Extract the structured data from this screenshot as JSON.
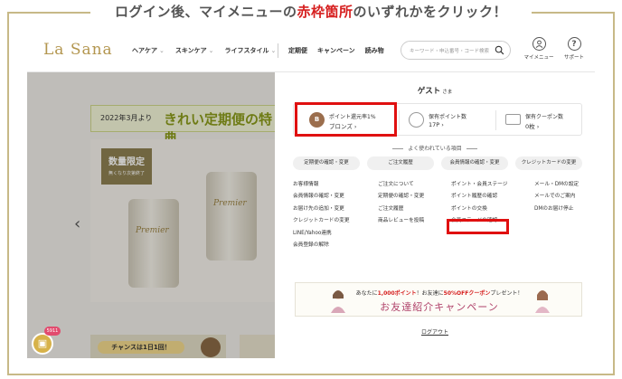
{
  "instruction": {
    "prefix": "ログイン後、マイメニューの",
    "highlight": "赤枠箇所",
    "suffix": "のいずれかをクリック！"
  },
  "header": {
    "logo": "La Sana",
    "nav": [
      "ヘアケア",
      "スキンケア",
      "ライフスタイル"
    ],
    "nav2": [
      "定期便",
      "キャンペーン",
      "読み物"
    ],
    "search_placeholder": "キーワード・申込番号・コード検索",
    "mymenu_label": "マイメニュー",
    "support_label": "サポート",
    "support_glyph": "?"
  },
  "background": {
    "banner_date": "2022年3月より",
    "banner_big": "きれい定期便の特典",
    "limited": "数量限定",
    "limited_sub": "無くなり次第終了",
    "can_label": "Premier",
    "chance": "チャンスは1日1回！",
    "gift_count": "5911",
    "bottom_right_text": "お友達紹介キャンペーン"
  },
  "panel": {
    "guest": "ゲスト",
    "guest_suffix": "さま",
    "rank_letter": "B",
    "rank_line1": "ポイント還元率1%",
    "rank_line2": "ブロンズ ›",
    "points_label": "保有ポイント数",
    "points_value": "17P ›",
    "coupons_label": "保有クーポン数",
    "coupons_value": "0枚 ›",
    "freq_title": "よく使われている項目",
    "pills": [
      "定期便の確認・変更",
      "ご注文履歴",
      "会員情報の確認・変更",
      "クレジットカードの変更"
    ],
    "col1": [
      "お客様情報",
      "会員情報の確認・変更",
      "お届け先の追加・変更",
      "クレジットカードの変更",
      "LINE/Yahoo連携",
      "会員登録の解除"
    ],
    "col2": [
      "ご注文について",
      "定期便の確認・変更",
      "ご注文履歴",
      "商品レビューを投稿"
    ],
    "col3": [
      "ポイント・会員ステージ",
      "ポイント履歴の確認",
      "ポイントの交換",
      "会員ステージの確認"
    ],
    "col4": [
      "メール・DMの設定",
      "メールでのご案内",
      "DMのお届け停止"
    ],
    "campaign_line1_a": "あなたに",
    "campaign_line1_b": "1,000ポイント",
    "campaign_line1_c": "！お友達に",
    "campaign_line1_d": "50%OFFクーポン",
    "campaign_line1_e": "プレゼント！",
    "campaign_line2": "お友達紹介キャンペーン",
    "logout": "ログアウト"
  },
  "colors": {
    "accent_gold": "#b3964f",
    "highlight_red": "#e01010",
    "frame": "#c7b987"
  }
}
